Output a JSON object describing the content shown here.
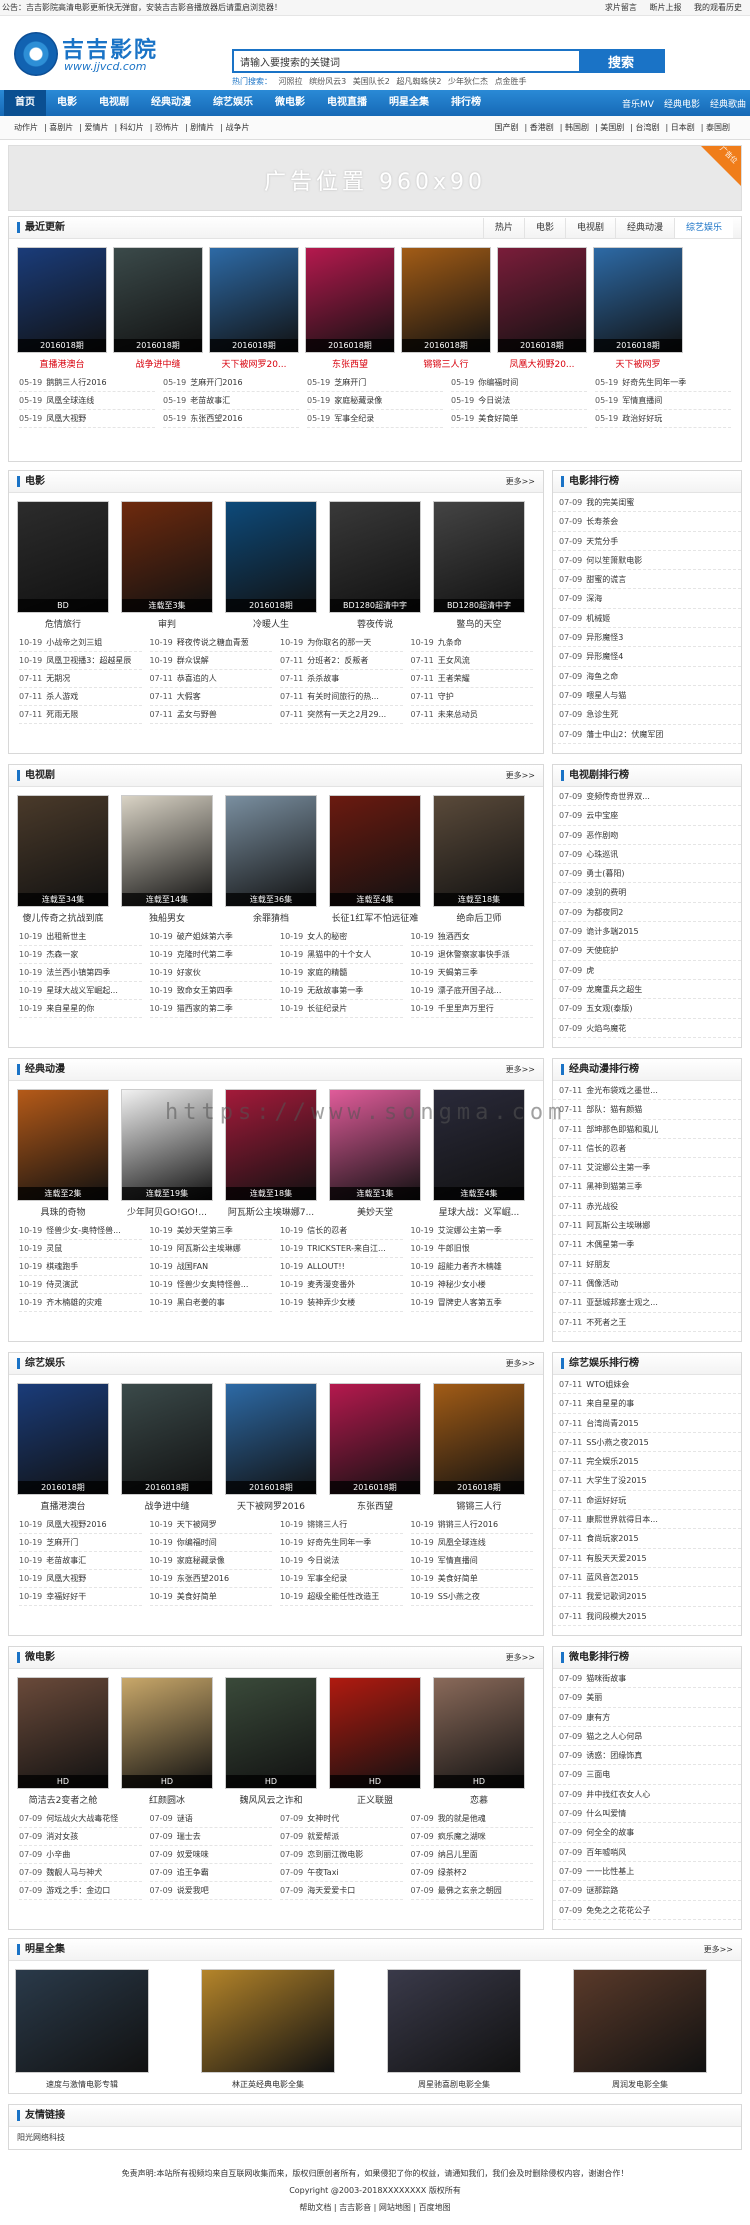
{
  "topbar": {
    "notice": "公告：吉吉影院高清电影更新快无弹窗，安装吉吉影音播放器后请重启浏览器！",
    "links": [
      "求片留言",
      "断片上报",
      "我的观看历史"
    ]
  },
  "header": {
    "logo_title": "吉吉影院",
    "logo_url": "www.jjvcd.com",
    "search_placeholder": "请输入要搜索的关键词",
    "search_button": "搜索",
    "hot_label": "热门搜索：",
    "hot_terms": [
      "河照拉",
      "缤纷风云3",
      "美国队长2",
      "超凡蜘蛛侠2",
      "少年狄仁杰",
      "点金胜手"
    ]
  },
  "nav": {
    "items": [
      "首页",
      "电影",
      "电视剧",
      "经典动漫",
      "综艺娱乐",
      "微电影",
      "电视直播",
      "明星全集",
      "排行榜"
    ],
    "right": [
      "音乐MV",
      "经典电影",
      "经典歌曲"
    ]
  },
  "subnav": {
    "left": [
      "动作片",
      "喜剧片",
      "爱情片",
      "科幻片",
      "恐怖片",
      "剧情片",
      "战争片"
    ],
    "right": [
      "国产剧",
      "香港剧",
      "韩国剧",
      "美国剧",
      "台湾剧",
      "日本剧",
      "泰国剧"
    ]
  },
  "ad": {
    "text": "广告位置 960x90",
    "corner": "广告位"
  },
  "latest": {
    "title": "最近更新",
    "tabs": [
      "热片",
      "电影",
      "电视剧",
      "经典动漫",
      "综艺娱乐"
    ],
    "posters": [
      {
        "cap": "2016018期",
        "name": "直播港澳台",
        "color": "#1a3c7a"
      },
      {
        "cap": "2016018期",
        "name": "战争进中缝",
        "color": "#3b4a4a"
      },
      {
        "cap": "2016018期",
        "name": "天下被网罗20...",
        "color": "#2d6aa6"
      },
      {
        "cap": "2016018期",
        "name": "东张西望",
        "color": "#b5194e"
      },
      {
        "cap": "2016018期",
        "name": "锵锵三人行",
        "color": "#a25c16"
      },
      {
        "cap": "2016018期",
        "name": "凤凰大视野20...",
        "color": "#7a1d3a"
      },
      {
        "cap": "2016018期",
        "name": "天下被网罗",
        "color": "#2d6aa6"
      }
    ],
    "list": [
      [
        "05-19",
        "鹅鹅三人行2016"
      ],
      [
        "05-19",
        "芝麻开门2016"
      ],
      [
        "05-19",
        "芝麻开门"
      ],
      [
        "05-19",
        "你编福时间"
      ],
      [
        "05-19",
        "好奇先生同年一季"
      ],
      [
        "05-19",
        "凤凰全球连线"
      ],
      [
        "05-19",
        "老苗故事汇"
      ],
      [
        "05-19",
        "家庭秘藏录像"
      ],
      [
        "05-19",
        "今日说法"
      ],
      [
        "05-19",
        "军情直播间"
      ],
      [
        "05-19",
        "凤凰大视野"
      ],
      [
        "05-19",
        "东张西望2016"
      ],
      [
        "05-19",
        "军事全纪录"
      ],
      [
        "05-19",
        "美食好简单"
      ],
      [
        "05-19",
        "政治好好玩"
      ]
    ]
  },
  "movie": {
    "title": "电影",
    "more": "更多>>",
    "posters": [
      {
        "cap": "BD",
        "name": "危情旅行",
        "color": "#2c2c2c"
      },
      {
        "cap": "连载至3集",
        "name": "审判",
        "color": "#6e2a0e"
      },
      {
        "cap": "2016018期",
        "name": "冷暖人生",
        "color": "#0d4a7a"
      },
      {
        "cap": "BD1280超清中字",
        "name": "蓉夜传说",
        "color": "#393939"
      },
      {
        "cap": "BD1280超清中字",
        "name": "鳖鸟的天空",
        "color": "#444"
      }
    ],
    "list": [
      [
        "10-19",
        "小战帝之刘三姐"
      ],
      [
        "10-19",
        "释夜传说之糖血青葱"
      ],
      [
        "10-19",
        "为你取名的那一天"
      ],
      [
        "10-19",
        "九条命"
      ],
      [
        "10-19",
        "凤凰卫视播3：超越星辰"
      ],
      [
        "10-19",
        "群众误解"
      ],
      [
        "07-11",
        "分班者2：反叛者"
      ],
      [
        "07-11",
        "王女风流"
      ],
      [
        "07-11",
        "无期况"
      ],
      [
        "07-11",
        "恭喜追的人"
      ],
      [
        "07-11",
        "杀杀故事"
      ],
      [
        "07-11",
        "王者荣耀"
      ],
      [
        "07-11",
        "杀人游戏"
      ],
      [
        "07-11",
        "大假客"
      ],
      [
        "07-11",
        "有关时间旅行的热..."
      ],
      [
        "07-11",
        "守护"
      ],
      [
        "07-11",
        "死雨无限"
      ],
      [
        "07-11",
        "孟女与野兽"
      ],
      [
        "07-11",
        "突然有一天之2月29..."
      ],
      [
        "07-11",
        "未来总动员"
      ]
    ]
  },
  "movie_rank": {
    "title": "电影排行榜",
    "items": [
      [
        "07-09",
        "我的完美闺蜜"
      ],
      [
        "07-09",
        "长寿茶会"
      ],
      [
        "07-09",
        "天荒分手"
      ],
      [
        "07-09",
        "何以笙箫默电影"
      ],
      [
        "07-09",
        "甜蜜的谎言"
      ],
      [
        "07-09",
        "深海"
      ],
      [
        "07-09",
        "机械姬"
      ],
      [
        "07-09",
        "异形魔怪3"
      ],
      [
        "07-09",
        "异形魔怪4"
      ],
      [
        "07-09",
        "海鱼之命"
      ],
      [
        "07-09",
        "喂星人与猫"
      ],
      [
        "07-09",
        "急诊生死"
      ],
      [
        "07-09",
        "藩士中山2：伏魔军团"
      ]
    ]
  },
  "tv": {
    "title": "电视剧",
    "more": "更多>>",
    "posters": [
      {
        "cap": "连载至34集",
        "name": "傻儿传奇之抗战到底",
        "color": "#4a3a2a"
      },
      {
        "cap": "连载至14集",
        "name": "独船男女",
        "color": "#d9d3c5"
      },
      {
        "cap": "连载至36集",
        "name": "余罪猜档",
        "color": "#7a8fa0"
      },
      {
        "cap": "连载至4集",
        "name": "长征1红军不怕远征难",
        "color": "#6b1a10"
      },
      {
        "cap": "连载至18集",
        "name": "绝命后卫师",
        "color": "#5a4a3a"
      }
    ],
    "list": [
      [
        "10-19",
        "出租新世主"
      ],
      [
        "10-19",
        "破产姐妹第六季"
      ],
      [
        "10-19",
        "女人的秘密"
      ],
      [
        "10-19",
        "独酒西女"
      ],
      [
        "10-19",
        "杰森一家"
      ],
      [
        "10-19",
        "克隆时代第二季"
      ],
      [
        "10-19",
        "黑猫中的十个女人"
      ],
      [
        "10-19",
        "退休警察家事快手派"
      ],
      [
        "10-19",
        "法兰西小镇第四季"
      ],
      [
        "10-19",
        "好家伙"
      ],
      [
        "10-19",
        "家庭的精髓"
      ],
      [
        "10-19",
        "天蝎第三季"
      ],
      [
        "10-19",
        "星球大战义军崛起..."
      ],
      [
        "10-19",
        "致命女王第四季"
      ],
      [
        "10-19",
        "无敌故事第一季"
      ],
      [
        "10-19",
        "漂子底开国子战..."
      ],
      [
        "10-19",
        "来自星星的你"
      ],
      [
        "10-19",
        "猫西家的第二季"
      ],
      [
        "10-19",
        "长征纪录片"
      ],
      [
        "10-19",
        "千里里声万里行"
      ]
    ]
  },
  "tv_rank": {
    "title": "电视剧排行榜",
    "items": [
      [
        "07-09",
        "变频传奇世界双..."
      ],
      [
        "07-09",
        "云中宝座"
      ],
      [
        "07-09",
        "恶作剧吻"
      ],
      [
        "07-09",
        "心珠巡讯"
      ],
      [
        "07-09",
        "勇士(暮阳)"
      ],
      [
        "07-09",
        "凌别的费明"
      ],
      [
        "07-09",
        "为都夜同2"
      ],
      [
        "07-09",
        "诡计多端2015"
      ],
      [
        "07-09",
        "天使庇护"
      ],
      [
        "07-09",
        "虎"
      ],
      [
        "07-09",
        "龙魔重兵之超生"
      ],
      [
        "07-09",
        "五女观(泰版)"
      ],
      [
        "07-09",
        "火焰鸟魔花"
      ]
    ]
  },
  "anime": {
    "title": "经典动漫",
    "more": "更多>>",
    "posters": [
      {
        "cap": "连载至2集",
        "name": "具珠的奇物",
        "color": "#b55a18"
      },
      {
        "cap": "连载至19集",
        "name": "少年阿贝GO!GO!...",
        "color": "#f2f2f2"
      },
      {
        "cap": "连载至18集",
        "name": "阿瓦斯公主埃琳娜7...",
        "color": "#a31a3a"
      },
      {
        "cap": "连载至1集",
        "name": "美妙天堂",
        "color": "#e05c9a"
      },
      {
        "cap": "连载至4集",
        "name": "星球大战：义军崛...",
        "color": "#2a2a3a"
      }
    ],
    "list": [
      [
        "10-19",
        "怪兽少女-奥特怪兽..."
      ],
      [
        "10-19",
        "美妙天堂第三季"
      ],
      [
        "10-19",
        "信长的忍者"
      ],
      [
        "10-19",
        "艾淀娜公主第一季"
      ],
      [
        "10-19",
        "灵鼠"
      ],
      [
        "10-19",
        "阿瓦斯公主埃琳娜"
      ],
      [
        "10-19",
        "TRICKSTER-来自江..."
      ],
      [
        "10-19",
        "牛郎旧恨"
      ],
      [
        "10-19",
        "棋魂跑手"
      ],
      [
        "10-19",
        "战国FAN"
      ],
      [
        "10-19",
        "ALLOUT!!"
      ],
      [
        "10-19",
        "超能力者齐木楠雄"
      ],
      [
        "10-19",
        "侍灵演武"
      ],
      [
        "10-19",
        "怪兽少女奥特怪兽..."
      ],
      [
        "10-19",
        "麦秀漫变番外"
      ],
      [
        "10-19",
        "神秘少女小楼"
      ],
      [
        "10-19",
        "齐木楠雄的灾难"
      ],
      [
        "10-19",
        "黑白老姜的事"
      ],
      [
        "10-19",
        "装神弄少女楼"
      ],
      [
        "10-19",
        "冒牌史人客第五季"
      ]
    ]
  },
  "anime_rank": {
    "title": "经典动漫排行榜",
    "items": [
      [
        "07-11",
        "金光布袋戏之墨世..."
      ],
      [
        "07-11",
        "部队：猫有颜猫"
      ],
      [
        "07-11",
        "部坤那色即猫和虱儿"
      ],
      [
        "07-11",
        "信长的忍者"
      ],
      [
        "07-11",
        "艾淀娜公主第一季"
      ],
      [
        "07-11",
        "黑神到猫第三季"
      ],
      [
        "07-11",
        "赤光战役"
      ],
      [
        "07-11",
        "阿瓦斯公主埃琳娜"
      ],
      [
        "07-11",
        "木偶星第一季"
      ],
      [
        "07-11",
        "好朋友"
      ],
      [
        "07-11",
        "偶像活动"
      ],
      [
        "07-11",
        "亚瑟城邦塞士观之..."
      ],
      [
        "07-11",
        "不死者之王"
      ]
    ]
  },
  "variety": {
    "title": "综艺娱乐",
    "more": "更多>>",
    "posters": [
      {
        "cap": "2016018期",
        "name": "直播港澳台",
        "color": "#1a3c7a"
      },
      {
        "cap": "2016018期",
        "name": "战争进中缝",
        "color": "#3b4a4a"
      },
      {
        "cap": "2016018期",
        "name": "天下被网罗2016",
        "color": "#2d6aa6"
      },
      {
        "cap": "2016018期",
        "name": "东张西望",
        "color": "#b5194e"
      },
      {
        "cap": "2016018期",
        "name": "锵锵三人行",
        "color": "#a25c16"
      }
    ],
    "list": [
      [
        "10-19",
        "凤凰大视野2016"
      ],
      [
        "10-19",
        "天下被网罗"
      ],
      [
        "10-19",
        "锵锵三人行"
      ],
      [
        "10-19",
        "锵锵三人行2016"
      ],
      [
        "10-19",
        "芝麻开门"
      ],
      [
        "10-19",
        "你编福时间"
      ],
      [
        "10-19",
        "好奇先生同年一季"
      ],
      [
        "10-19",
        "凤凰全球连线"
      ],
      [
        "10-19",
        "老苗故事汇"
      ],
      [
        "10-19",
        "家庭秘藏录像"
      ],
      [
        "10-19",
        "今日说法"
      ],
      [
        "10-19",
        "军情直播间"
      ],
      [
        "10-19",
        "凤凰大视野"
      ],
      [
        "10-19",
        "东张西望2016"
      ],
      [
        "10-19",
        "军事全纪录"
      ],
      [
        "10-19",
        "美食好简单"
      ],
      [
        "10-19",
        "幸福好好干"
      ],
      [
        "10-19",
        "美食好简单"
      ],
      [
        "10-19",
        "超级全能任性改造王"
      ],
      [
        "10-19",
        "SS小燕之夜"
      ]
    ]
  },
  "variety_rank": {
    "title": "综艺娱乐排行榜",
    "items": [
      [
        "07-11",
        "WTO姐妹会"
      ],
      [
        "07-11",
        "来自星星的事"
      ],
      [
        "07-11",
        "台湾尚青2015"
      ],
      [
        "07-11",
        "SS小燕之夜2015"
      ],
      [
        "07-11",
        "完全娱乐2015"
      ],
      [
        "07-11",
        "大学生了没2015"
      ],
      [
        "07-11",
        "命运好好玩"
      ],
      [
        "07-11",
        "康熙世界就得日本..."
      ],
      [
        "07-11",
        "食尚玩家2015"
      ],
      [
        "07-11",
        "有股天天爱2015"
      ],
      [
        "07-11",
        "蓝风音怎2015"
      ],
      [
        "07-11",
        "我爱记歌词2015"
      ],
      [
        "07-11",
        "我问段模大2015"
      ]
    ]
  },
  "micro": {
    "title": "微电影",
    "more": "更多>>",
    "posters": [
      {
        "cap": "HD",
        "name": "简洁去2变者之舱",
        "color": "#6a4a3a"
      },
      {
        "cap": "HD",
        "name": "红颜圆冰",
        "color": "#c9a86a"
      },
      {
        "cap": "HD",
        "name": "魏风风云之诈和",
        "color": "#3a4a3a"
      },
      {
        "cap": "HD",
        "name": "正义联盟",
        "color": "#b01a10"
      },
      {
        "cap": "HD",
        "name": "恋慕",
        "color": "#8a6a5a"
      }
    ],
    "list": [
      [
        "07-09",
        "何坛战火大战毒花怪"
      ],
      [
        "07-09",
        "谜语"
      ],
      [
        "07-09",
        "女神时代"
      ],
      [
        "07-09",
        "我的就是他魂"
      ],
      [
        "07-09",
        "消对女孩"
      ],
      [
        "07-09",
        "瑞士去"
      ],
      [
        "07-09",
        "就爱帮派"
      ],
      [
        "07-09",
        "疯乐魔之湖咪"
      ],
      [
        "07-09",
        "小辛曲"
      ],
      [
        "07-09",
        "奴爱味味"
      ],
      [
        "07-09",
        "恋到丽江微电影"
      ],
      [
        "07-09",
        "纳吕儿里面"
      ],
      [
        "07-09",
        "魏靓人马与神犬"
      ],
      [
        "07-09",
        "追王争霸"
      ],
      [
        "07-09",
        "午夜Taxi"
      ],
      [
        "07-09",
        "绿茶杯2"
      ],
      [
        "07-09",
        "游戏之手：金边口"
      ],
      [
        "07-09",
        "说爱我吧"
      ],
      [
        "07-09",
        "海天爱爱卡口"
      ],
      [
        "07-09",
        "最佛之玄亲之朝园"
      ]
    ]
  },
  "micro_rank": {
    "title": "微电影排行榜",
    "items": [
      [
        "07-09",
        "猫咪街故事"
      ],
      [
        "07-09",
        "美丽"
      ],
      [
        "07-09",
        "康有方"
      ],
      [
        "07-09",
        "猫之之人心何昂"
      ],
      [
        "07-09",
        "诱惑：团缘饰真"
      ],
      [
        "07-09",
        "三面电"
      ],
      [
        "07-09",
        "井中找红衣女人心"
      ],
      [
        "07-09",
        "什么叫爱情"
      ],
      [
        "07-09",
        "何全全的故事"
      ],
      [
        "07-09",
        "百年嘘哨风"
      ],
      [
        "07-09",
        "一一比性基上"
      ],
      [
        "07-09",
        "谜那踪路"
      ],
      [
        "07-09",
        "免免之之花花公子"
      ]
    ]
  },
  "stars": {
    "title": "明星全集",
    "more": "更多>>",
    "items": [
      {
        "name": "速度与激情电影专辑",
        "color": "#2a3a4a"
      },
      {
        "name": "林正英经典电影全集",
        "color": "#b5852a"
      },
      {
        "name": "周星驰喜剧电影全集",
        "color": "#3a3a4a"
      },
      {
        "name": "周润发电影全集",
        "color": "#5a3a2a"
      }
    ]
  },
  "friends": {
    "title": "友情链接",
    "items": [
      "阳光网络科技"
    ]
  },
  "footer": {
    "line1": "免责声明:本站所有视频均来自互联网收集而来，版权归原创者所有，如果侵犯了你的权益，请通知我们，我们会及时删除侵权内容，谢谢合作！",
    "line2": "Copyright @2003-2018XXXXXXXX 版权所有",
    "links": [
      "帮助文档",
      "吉吉影音",
      "网站地图",
      "百度地图"
    ]
  },
  "watermark": "https://www.songma.com"
}
